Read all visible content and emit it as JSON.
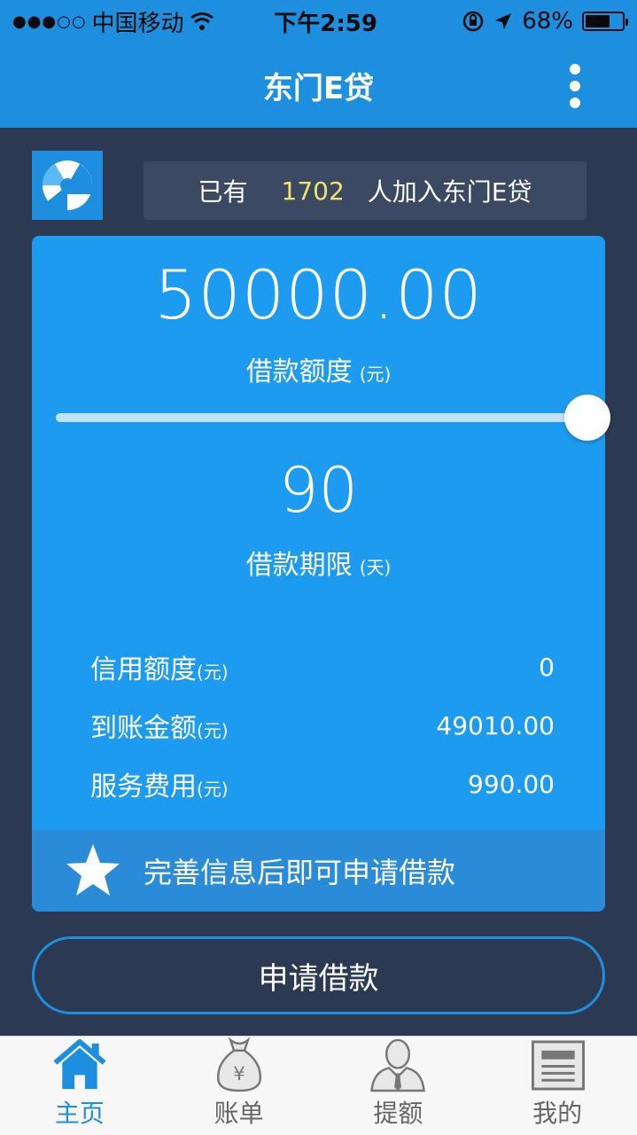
{
  "status_bar": {
    "carrier": "中国移动",
    "time": "下午2:59",
    "battery": "68%",
    "battery_level": 0.68
  },
  "nav": {
    "title": "东门E贷"
  },
  "banner": {
    "prefix": "已有",
    "count": "1702",
    "suffix": "人加入东门E贷"
  },
  "loan": {
    "amount": "50000.00",
    "amount_label": "借款额度",
    "amount_unit": "(元)",
    "slider_level": 1.0,
    "term": "90",
    "term_label": "借款期限",
    "term_unit": "(天)",
    "details": [
      {
        "label": "信用额度",
        "unit": "(元)",
        "value": "0"
      },
      {
        "label": "到账金额",
        "unit": "(元)",
        "value": "49010.00"
      },
      {
        "label": "服务费用",
        "unit": "(元)",
        "value": "990.00"
      }
    ],
    "notice": "完善信息后即可申请借款"
  },
  "apply_button": "申请借款",
  "tabs": [
    {
      "label": "主页",
      "icon": "home-icon",
      "active": true
    },
    {
      "label": "账单",
      "icon": "money-bag-icon",
      "active": false
    },
    {
      "label": "提额",
      "icon": "user-icon",
      "active": false
    },
    {
      "label": "我的",
      "icon": "document-icon",
      "active": false
    }
  ],
  "colors": {
    "primary": "#1e8fde",
    "card": "#1d9bf0",
    "background": "#2b3a52",
    "highlight": "#f5e46b"
  }
}
